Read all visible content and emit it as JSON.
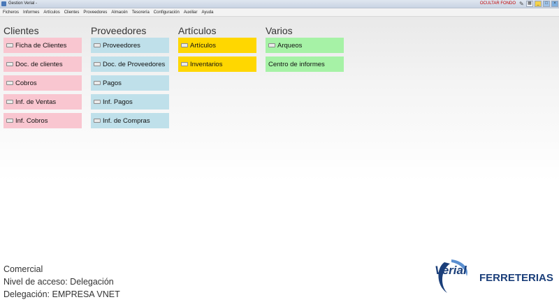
{
  "window": {
    "title": "Gestion Verial -",
    "ocultar_fondo": "OCULTAR FONDO"
  },
  "menu": [
    "Ficheros",
    "Informes",
    "Artículos",
    "Clientes",
    "Proveedores",
    "Almacén",
    "Tesorería",
    "Configuración",
    "Auxiliar",
    "Ayuda"
  ],
  "columns": {
    "clientes": {
      "title": "Clientes",
      "items": [
        "Ficha de Clientes",
        "Doc. de clientes",
        "Cobros",
        "Inf. de Ventas",
        "Inf. Cobros"
      ]
    },
    "proveedores": {
      "title": "Proveedores",
      "items": [
        "Proveedores",
        "Doc. de Proveedores",
        "Pagos",
        "Inf. Pagos",
        "Inf. de Compras"
      ]
    },
    "articulos": {
      "title": "Artículos",
      "items": [
        "Artículos",
        "Inventarios"
      ]
    },
    "varios": {
      "title": "Varios",
      "items": [
        "Arqueos",
        "Centro de informes"
      ]
    }
  },
  "footer": {
    "line1": "Comercial",
    "line2": "Nivel de acceso: Delegación",
    "line3": "Delegación: EMPRESA VNET"
  },
  "brand": {
    "logo": "Verial",
    "name": "FERRETERIAS"
  },
  "colors": {
    "clientes": "#f9c6d0",
    "proveedores": "#bfe0ea",
    "articulos": "#ffd700",
    "varios": "#a6f2a6"
  }
}
